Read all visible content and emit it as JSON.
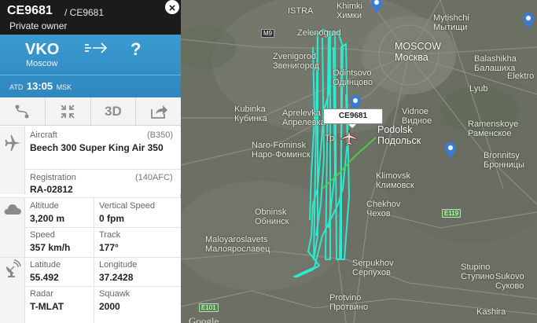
{
  "flight": {
    "id": "CE9681",
    "callsign": "/ CE9681",
    "owner": "Private owner",
    "close_symbol": "×"
  },
  "route": {
    "origin_code": "VKO",
    "origin_city": "Moscow",
    "destination_code": "?",
    "atd_label": "ATD",
    "atd_time": "13:05",
    "atd_tz": "MSK"
  },
  "toolbar": {
    "route_icon": "route-icon",
    "collapse_icon": "collapse-icon",
    "view_3d_label": "3D",
    "share_icon": "share-icon"
  },
  "aircraft": {
    "label": "Aircraft",
    "type_code": "(B350)",
    "name": "Beech 300 Super King Air 350",
    "registration_label": "Registration",
    "registration_hex": "(140AFC)",
    "registration": "RA-02812"
  },
  "metrics": {
    "altitude_label": "Altitude",
    "altitude": "3,200 m",
    "vspeed_label": "Vertical Speed",
    "vspeed": "0 fpm",
    "speed_label": "Speed",
    "speed": "357 km/h",
    "track_label": "Track",
    "track": "177°"
  },
  "position": {
    "lat_label": "Latitude",
    "lat": "55.492",
    "lon_label": "Longitude",
    "lon": "37.2428",
    "radar_label": "Radar",
    "radar": "T-MLAT",
    "squawk_label": "Squawk",
    "squawk": "2000"
  },
  "map": {
    "tooltip": "CE9681",
    "attribution": "Google",
    "track_color": "#2ee8d0",
    "route_line_color": "#4bd14b",
    "cities": {
      "istra": "ISTRA",
      "khimki": "Khimki\nХимки",
      "mytishchi": "Mytishchi\nМытищи",
      "zelenograd": "Zelenograd",
      "zvenigorod": "Zvenigorod\nЗвенигород",
      "moscow": "MOSCOW\nМосква",
      "balashikha": "Balashikha\nБалашиха",
      "elektro": "Elektro",
      "odintsovo": "Odintsovo\nОдинцово",
      "lyubertsy": "Lyub",
      "kubinka": "Kubinka\nКубинка",
      "aprelevka": "Aprelevka\nАпрелевка",
      "vidnoe": "Vidnoe\nВидное",
      "podolsk": "Podolsk\nПодольск",
      "ramenskoye": "Ramenskoye\nРаменское",
      "naro_fominsk": "Naro-Fominsk\nНаро-Фоминск",
      "troitsk": "Тр",
      "bronnitsy": "Bronnitsy\nБронницы",
      "klimovsk": "Klimovsk\nКлимовск",
      "obninsk": "Obninsk\nОбнинск",
      "chekhov": "Chekhov\nЧехов",
      "maloyaroslavets": "Maloyaroslavets\nМалоярославец",
      "serpukhov": "Serpukhov\nСерпухов",
      "stupino": "Stupino\nСтупино",
      "sukovo": "Sukovo\nСуково",
      "protvino": "Protvino\nПротвино",
      "kashira": "Kashira"
    },
    "shields": {
      "m9": "M9",
      "e119": "E119",
      "e101": "E101"
    }
  }
}
